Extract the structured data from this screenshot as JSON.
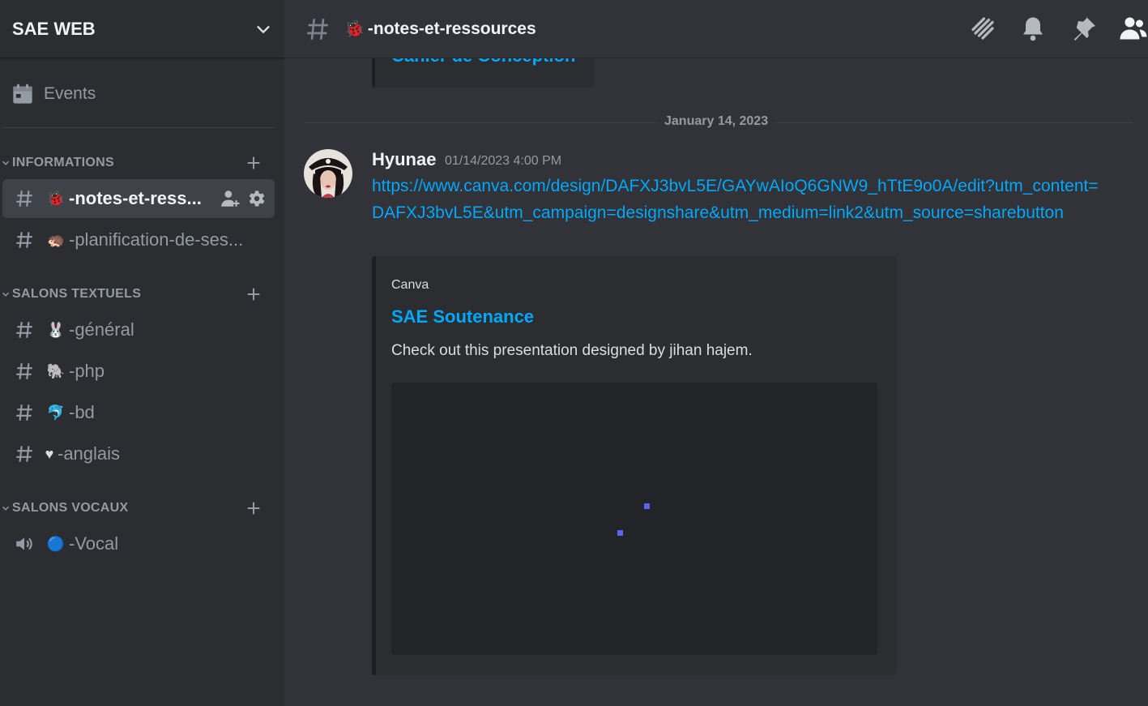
{
  "server": {
    "name": "SAE WEB"
  },
  "sidebar": {
    "events_label": "Events",
    "categories": [
      {
        "label": "INFORMATIONS",
        "channels": [
          {
            "emoji": "🐞",
            "name": "-notes-et-ress..."
          },
          {
            "emoji": "🦔",
            "name": "-planification-de-ses..."
          }
        ]
      },
      {
        "label": "SALONS TEXTUELS",
        "channels": [
          {
            "emoji": "🐰",
            "name": "-général"
          },
          {
            "emoji": "🐘",
            "name": "-php"
          },
          {
            "emoji": "🐬",
            "name": "-bd"
          },
          {
            "emoji": "♥",
            "name": "-anglais"
          }
        ]
      },
      {
        "label": "SALONS VOCAUX",
        "channels": [
          {
            "emoji": "🔵",
            "name": "-Vocal"
          }
        ]
      }
    ]
  },
  "topbar": {
    "channel_emoji": "🐞",
    "channel_name": "-notes-et-ressources",
    "icons": [
      "threads-icon",
      "bell-icon",
      "pin-icon",
      "members-icon"
    ]
  },
  "chat": {
    "previous_embed_title": "Cahier de Conception",
    "date_divider": "January 14, 2023",
    "message": {
      "author": "Hyunae",
      "timestamp": "01/14/2023 4:00 PM",
      "link": "https://www.canva.com/design/DAFXJ3bvL5E/GAYwAIoQ6GNW9_hTtE9o0A/edit?utm_content=DAFXJ3bvL5E&utm_campaign=designshare&utm_medium=link2&utm_source=sharebutton",
      "embed": {
        "provider": "Canva",
        "title": "SAE Soutenance",
        "description": "Check out this presentation designed by jihan hajem."
      }
    }
  },
  "colors": {
    "link": "#00a8fc",
    "sidebar_bg": "#2b2d31",
    "main_bg": "#313338",
    "accent": "#5865f2"
  }
}
